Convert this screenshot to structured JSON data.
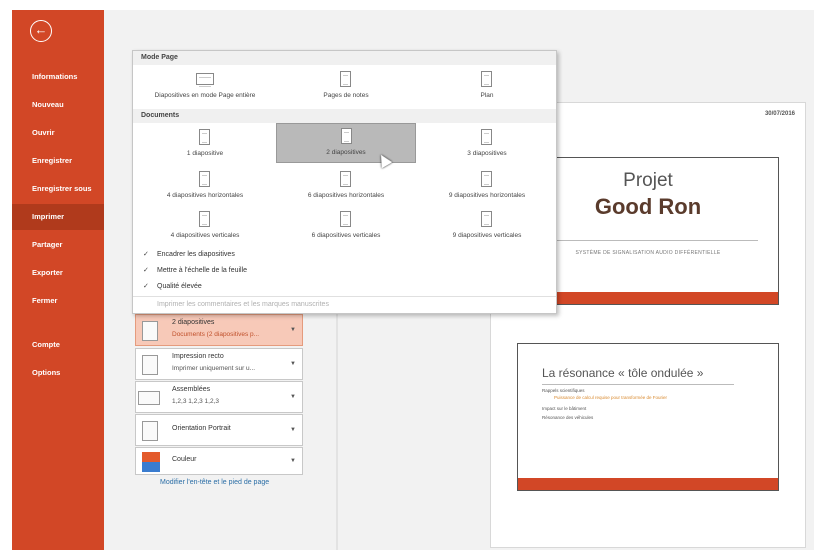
{
  "sidebar": {
    "back_symbol": "←",
    "items": [
      {
        "label": "Informations",
        "active": false
      },
      {
        "label": "Nouveau",
        "active": false
      },
      {
        "label": "Ouvrir",
        "active": false
      },
      {
        "label": "Enregistrer",
        "active": false
      },
      {
        "label": "Enregistrer sous",
        "active": false
      },
      {
        "label": "Imprimer",
        "active": true
      },
      {
        "label": "Partager",
        "active": false
      },
      {
        "label": "Exporter",
        "active": false
      },
      {
        "label": "Fermer",
        "active": false
      },
      {
        "label": "Compte",
        "active": false
      },
      {
        "label": "Options",
        "active": false
      }
    ]
  },
  "dropdown": {
    "section_page_mode": "Mode Page",
    "page_modes": [
      {
        "label": "Diapositives en mode Page entière",
        "icon": "landscape-page-icon"
      },
      {
        "label": "Pages de notes",
        "icon": "notes-page-icon"
      },
      {
        "label": "Plan",
        "icon": "outline-page-icon"
      }
    ],
    "section_documents": "Documents",
    "documents": [
      {
        "label": "1 diapositive",
        "selected": false
      },
      {
        "label": "2 diapositives",
        "selected": true
      },
      {
        "label": "3 diapositives",
        "selected": false
      },
      {
        "label": "4 diapositives horizontales",
        "selected": false
      },
      {
        "label": "6 diapositives horizontales",
        "selected": false
      },
      {
        "label": "9 diapositives horizontales",
        "selected": false
      },
      {
        "label": "4 diapositives verticales",
        "selected": false
      },
      {
        "label": "6 diapositives verticales",
        "selected": false
      },
      {
        "label": "9 diapositives verticales",
        "selected": false
      }
    ],
    "options": [
      {
        "label": "Encadrer les diapositives",
        "checked": true,
        "disabled": false
      },
      {
        "label": "Mettre à l'échelle de la feuille",
        "checked": true,
        "disabled": false
      },
      {
        "label": "Qualité élevée",
        "checked": true,
        "disabled": false
      },
      {
        "label": "Imprimer les commentaires et les marques manuscrites",
        "checked": false,
        "disabled": true
      }
    ],
    "check_symbol": "✓"
  },
  "settings": {
    "layout": {
      "title": "2 diapositives",
      "subtitle": "Documents (2 diapositives p..."
    },
    "sides": {
      "title": "Impression recto",
      "subtitle": "Imprimer uniquement sur u..."
    },
    "collate": {
      "title": "Assemblées",
      "subtitle": "1,2,3   1,2,3   1,2,3"
    },
    "orientation": {
      "title": "Orientation Portrait"
    },
    "color": {
      "title": "Couleur"
    },
    "footer_link": "Modifier l'en-tête et le pied de page",
    "dropdown_arrow": "▼"
  },
  "preview": {
    "date": "30/07/2016",
    "slide1": {
      "title_line1": "Projet",
      "title_line2": "Good Ron",
      "subtitle": "SYSTÈME DE SIGNALISATION AUDIO DIFFÉRENTIELLE"
    },
    "slide2": {
      "title": "La résonance « tôle ondulée »",
      "lines": [
        "Rappels scientifiques",
        "Puissance de calcul requise pour transformée de Fourier",
        "Impact sur le bâtiment",
        "Résonance des véhicules"
      ]
    }
  },
  "colors": {
    "accent": "#d24726",
    "accent_dark": "#b03a1c",
    "selection": "#f7c9b8"
  }
}
